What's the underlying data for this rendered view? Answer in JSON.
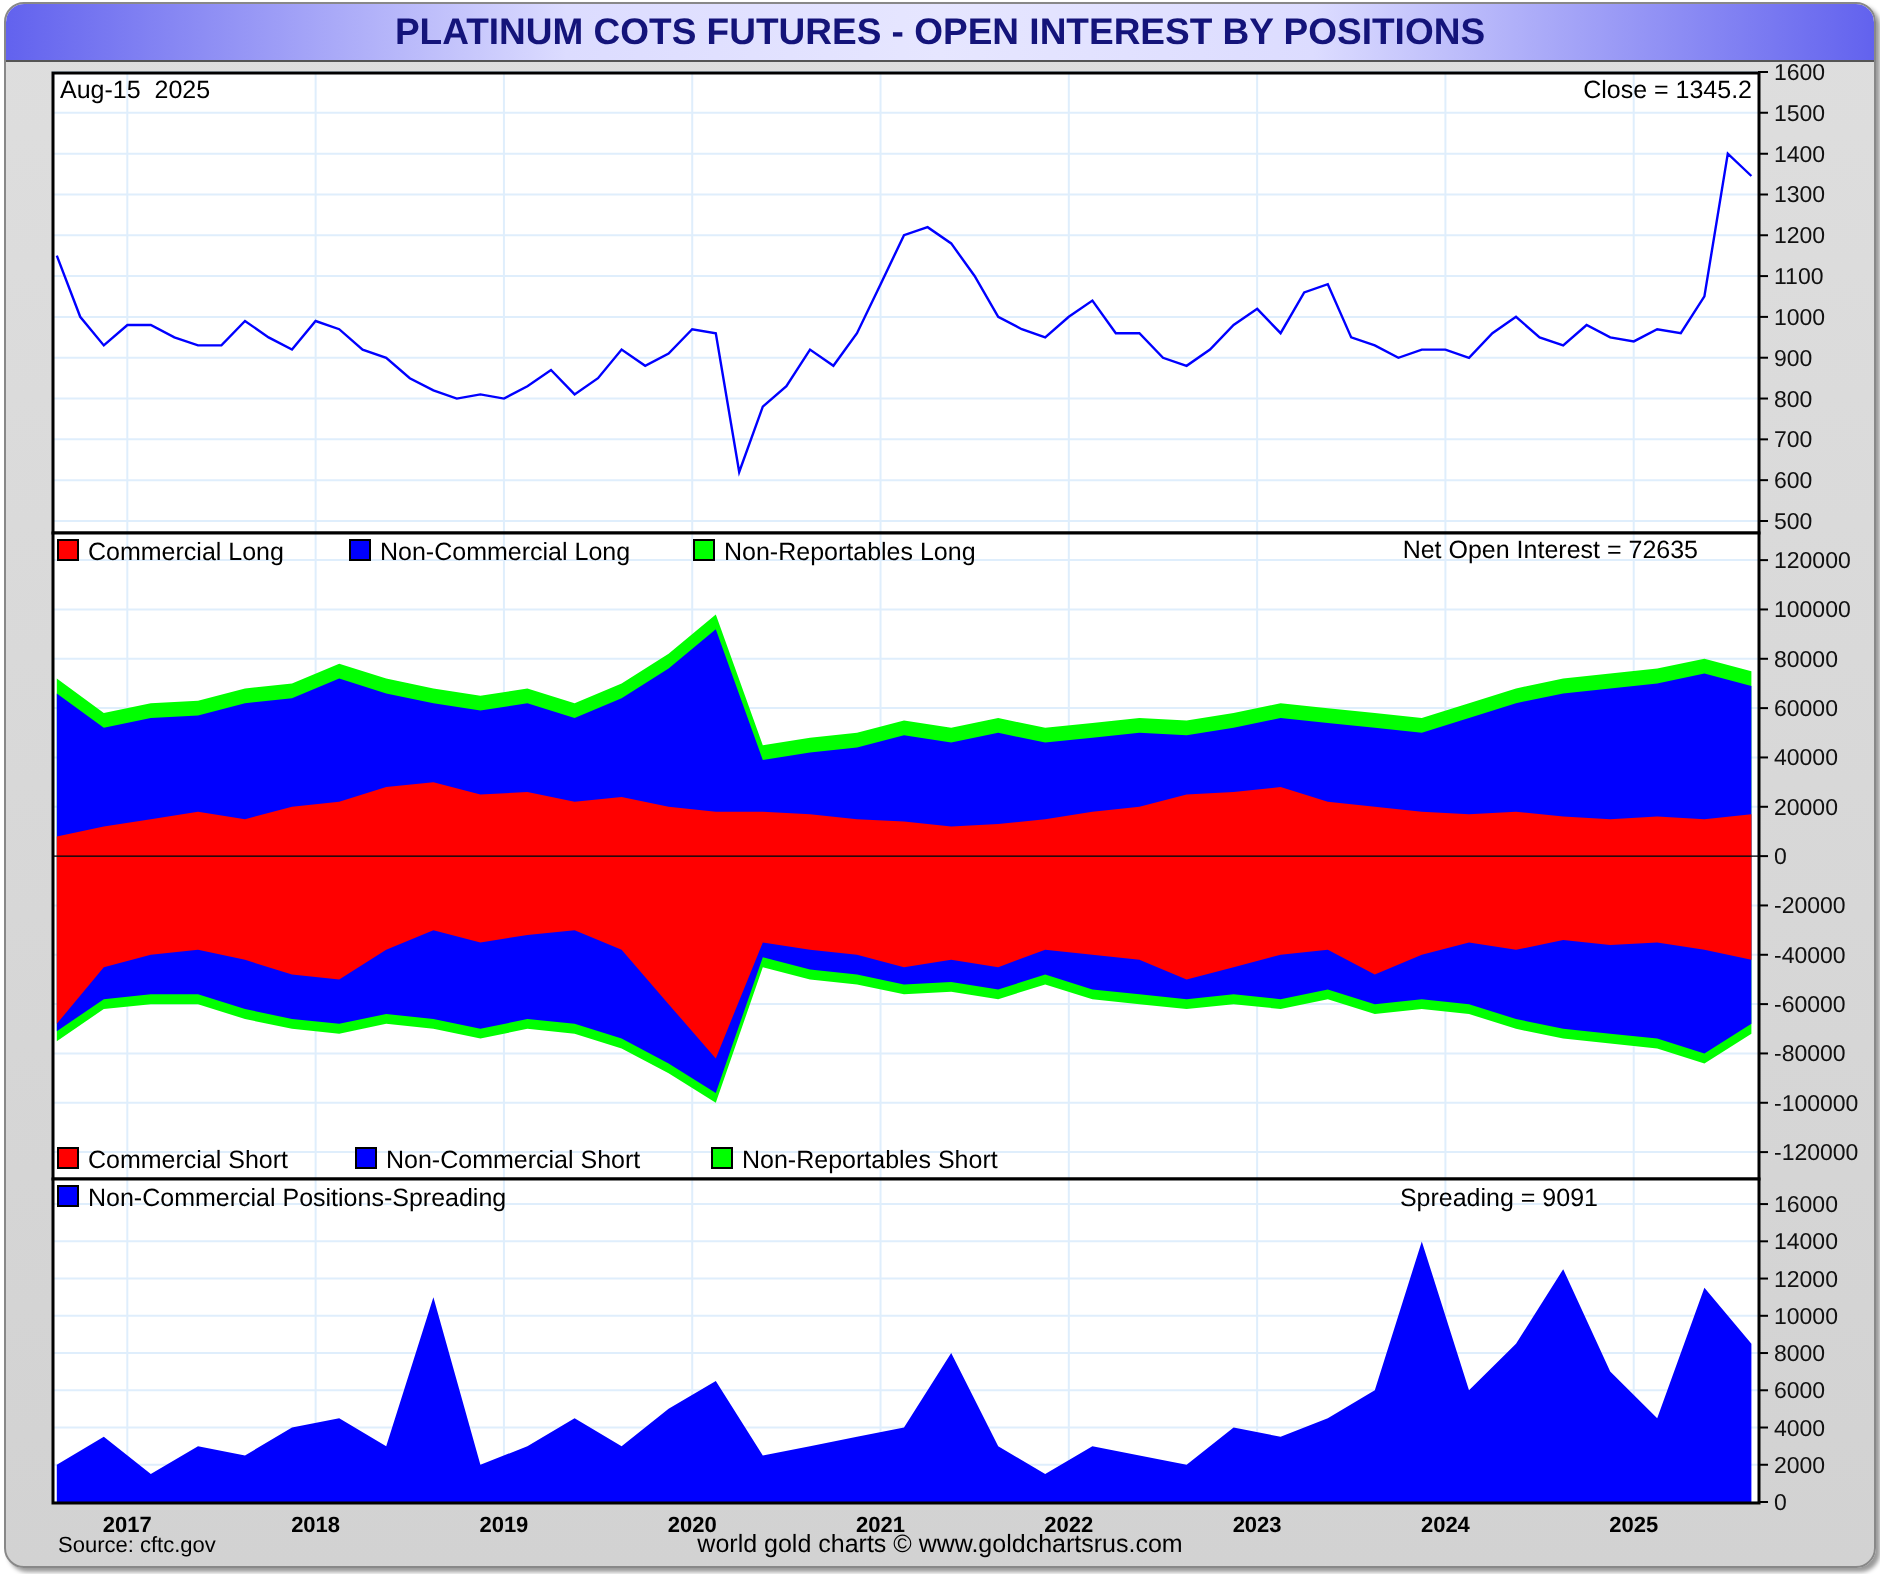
{
  "title": "PLATINUM COTS FUTURES - OPEN INTEREST BY POSITIONS",
  "price_panel": {
    "date": "Aug-15  2025",
    "close_label": "Close = 1345.2",
    "chart_data": {
      "type": "line",
      "grid": true,
      "xlim": [
        2016.6,
        2025.66
      ],
      "ylim": [
        473,
        1600
      ],
      "yticks": [
        500,
        600,
        700,
        800,
        900,
        1000,
        1100,
        1200,
        1300,
        1400,
        1500,
        1600
      ],
      "x": [
        2016.625,
        2016.75,
        2016.875,
        2017,
        2017.125,
        2017.25,
        2017.375,
        2017.5,
        2017.625,
        2017.75,
        2017.875,
        2018,
        2018.125,
        2018.25,
        2018.375,
        2018.5,
        2018.625,
        2018.75,
        2018.875,
        2019,
        2019.125,
        2019.25,
        2019.375,
        2019.5,
        2019.625,
        2019.75,
        2019.875,
        2020,
        2020.125,
        2020.25,
        2020.375,
        2020.5,
        2020.625,
        2020.75,
        2020.875,
        2021,
        2021.125,
        2021.25,
        2021.375,
        2021.5,
        2021.625,
        2021.75,
        2021.875,
        2022,
        2022.125,
        2022.25,
        2022.375,
        2022.5,
        2022.625,
        2022.75,
        2022.875,
        2023,
        2023.125,
        2023.25,
        2023.375,
        2023.5,
        2023.625,
        2023.75,
        2023.875,
        2024,
        2024.125,
        2024.25,
        2024.375,
        2024.5,
        2024.625,
        2024.75,
        2024.875,
        2025,
        2025.125,
        2025.25,
        2025.375,
        2025.5,
        2025.625
      ],
      "series": [
        {
          "color": "#0000ff",
          "values": [
            1150,
            1000,
            930,
            980,
            980,
            950,
            930,
            930,
            990,
            950,
            920,
            990,
            970,
            920,
            900,
            850,
            820,
            800,
            810,
            800,
            830,
            870,
            810,
            850,
            920,
            880,
            910,
            970,
            960,
            620,
            780,
            830,
            920,
            880,
            960,
            1080,
            1200,
            1220,
            1180,
            1100,
            1000,
            970,
            950,
            1000,
            1040,
            960,
            960,
            900,
            880,
            920,
            980,
            1020,
            960,
            1060,
            1080,
            950,
            930,
            900,
            920,
            920,
            900,
            960,
            1000,
            950,
            930,
            980,
            950,
            940,
            970,
            960,
            1050,
            1400,
            1345
          ]
        }
      ]
    }
  },
  "positions_panel": {
    "net_label": "Net Open Interest = 72635",
    "chart_data": {
      "type": "area",
      "stacked": false,
      "grid": true,
      "legend": true,
      "xlim": [
        2016.6,
        2025.66
      ],
      "ylim": [
        -130500,
        131400
      ],
      "yticks": [
        -120000,
        -100000,
        -80000,
        -60000,
        -40000,
        -20000,
        0,
        20000,
        40000,
        60000,
        80000,
        100000,
        120000
      ],
      "x": [
        2016.625,
        2016.875,
        2017.125,
        2017.375,
        2017.625,
        2017.875,
        2018.125,
        2018.375,
        2018.625,
        2018.875,
        2019.125,
        2019.375,
        2019.625,
        2019.875,
        2020.125,
        2020.375,
        2020.625,
        2020.875,
        2021.125,
        2021.375,
        2021.625,
        2021.875,
        2022.125,
        2022.375,
        2022.625,
        2022.875,
        2023.125,
        2023.375,
        2023.625,
        2023.875,
        2024.125,
        2024.375,
        2024.625,
        2024.875,
        2025.125,
        2025.375,
        2025.625
      ],
      "series": [
        {
          "name": "Commercial Long",
          "color": "#ff0000",
          "values": [
            8000,
            12000,
            15000,
            18000,
            15000,
            20000,
            22000,
            28000,
            30000,
            25000,
            26000,
            22000,
            24000,
            20000,
            18000,
            18000,
            17000,
            15000,
            14000,
            12000,
            13000,
            15000,
            18000,
            20000,
            25000,
            26000,
            28000,
            22000,
            20000,
            18000,
            17000,
            18000,
            16000,
            15000,
            16000,
            15000,
            17000
          ]
        },
        {
          "name": "Non-Commercial Long",
          "color": "#0000ff",
          "values": [
            66000,
            52000,
            56000,
            57000,
            62000,
            64000,
            72000,
            66000,
            62000,
            59000,
            62000,
            56000,
            64000,
            76000,
            92000,
            39000,
            42000,
            44000,
            49000,
            46000,
            50000,
            46000,
            48000,
            50000,
            49000,
            52000,
            56000,
            54000,
            52000,
            50000,
            56000,
            62000,
            66000,
            68000,
            70000,
            74000,
            69000
          ]
        },
        {
          "name": "Non-Reportables Long",
          "color": "#00ff00",
          "values": [
            72000,
            58000,
            62000,
            63000,
            68000,
            70000,
            78000,
            72000,
            68000,
            65000,
            68000,
            62000,
            70000,
            82000,
            98000,
            45000,
            48000,
            50000,
            55000,
            52000,
            56000,
            52000,
            54000,
            56000,
            55000,
            58000,
            62000,
            60000,
            58000,
            56000,
            62000,
            68000,
            72000,
            74000,
            76000,
            80000,
            75000
          ]
        },
        {
          "name": "Commercial Short",
          "color": "#ff0000",
          "values": [
            -68000,
            -45000,
            -40000,
            -38000,
            -42000,
            -48000,
            -50000,
            -38000,
            -30000,
            -35000,
            -32000,
            -30000,
            -38000,
            -60000,
            -82000,
            -35000,
            -38000,
            -40000,
            -45000,
            -42000,
            -45000,
            -38000,
            -40000,
            -42000,
            -50000,
            -45000,
            -40000,
            -38000,
            -48000,
            -40000,
            -35000,
            -38000,
            -34000,
            -36000,
            -35000,
            -38000,
            -42000
          ]
        },
        {
          "name": "Non-Commercial Short",
          "color": "#0000ff",
          "values": [
            -71000,
            -58000,
            -56000,
            -56000,
            -62000,
            -66000,
            -68000,
            -64000,
            -66000,
            -70000,
            -66000,
            -68000,
            -74000,
            -84000,
            -96000,
            -41000,
            -46000,
            -48000,
            -52000,
            -51000,
            -54000,
            -48000,
            -54000,
            -56000,
            -58000,
            -56000,
            -58000,
            -54000,
            -60000,
            -58000,
            -60000,
            -66000,
            -70000,
            -72000,
            -74000,
            -80000,
            -68000
          ]
        },
        {
          "name": "Non-Reportables Short",
          "color": "#00ff00",
          "values": [
            -75000,
            -62000,
            -60000,
            -60000,
            -66000,
            -70000,
            -72000,
            -68000,
            -70000,
            -74000,
            -70000,
            -72000,
            -78000,
            -88000,
            -100000,
            -45000,
            -50000,
            -52000,
            -56000,
            -55000,
            -58000,
            -52000,
            -58000,
            -60000,
            -62000,
            -60000,
            -62000,
            -58000,
            -64000,
            -62000,
            -64000,
            -70000,
            -74000,
            -76000,
            -78000,
            -84000,
            -72000
          ]
        }
      ]
    }
  },
  "spreading_panel": {
    "spreading_label": "Spreading = 9091",
    "chart_data": {
      "type": "area",
      "grid": true,
      "legend": true,
      "xlim": [
        2016.6,
        2025.66
      ],
      "ylim": [
        0,
        17400
      ],
      "yticks": [
        0,
        2000,
        4000,
        6000,
        8000,
        10000,
        12000,
        14000,
        16000
      ],
      "xticks": [
        2017,
        2018,
        2019,
        2020,
        2021,
        2022,
        2023,
        2024,
        2025
      ],
      "x": [
        2016.625,
        2016.875,
        2017.125,
        2017.375,
        2017.625,
        2017.875,
        2018.125,
        2018.375,
        2018.625,
        2018.875,
        2019.125,
        2019.375,
        2019.625,
        2019.875,
        2020.125,
        2020.375,
        2020.625,
        2020.875,
        2021.125,
        2021.375,
        2021.625,
        2021.875,
        2022.125,
        2022.375,
        2022.625,
        2022.875,
        2023.125,
        2023.375,
        2023.625,
        2023.875,
        2024.125,
        2024.375,
        2024.625,
        2024.875,
        2025.125,
        2025.375,
        2025.625
      ],
      "series": [
        {
          "name": "Non-Commercial Positions-Spreading",
          "color": "#0000ff",
          "values": [
            2000,
            3500,
            1500,
            3000,
            2500,
            4000,
            4500,
            3000,
            11000,
            2000,
            3000,
            4500,
            3000,
            5000,
            6500,
            2500,
            3000,
            3500,
            4000,
            8000,
            3000,
            1500,
            3000,
            2500,
            2000,
            4000,
            3500,
            4500,
            6000,
            14000,
            6000,
            8500,
            12500,
            7000,
            4500,
            11500,
            8500
          ]
        }
      ]
    }
  },
  "source": "Source: cftc.gov",
  "credit": "world gold charts © www.goldchartsrus.com"
}
